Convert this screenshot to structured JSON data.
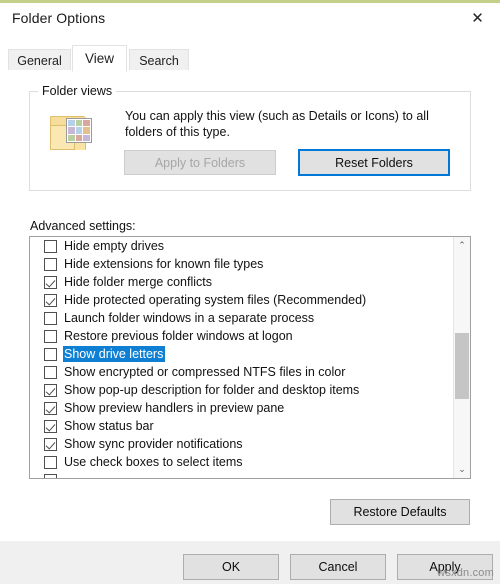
{
  "window": {
    "title": "Folder Options",
    "close_icon": "close-icon",
    "close_glyph": "✕"
  },
  "tabs": [
    {
      "label": "General",
      "selected": false
    },
    {
      "label": "View",
      "selected": true
    },
    {
      "label": "Search",
      "selected": false
    }
  ],
  "folder_views": {
    "legend": "Folder views",
    "description": "You can apply this view (such as Details or Icons) to all folders of this type.",
    "apply_to_folders_label": "Apply to Folders",
    "apply_to_folders_enabled": false,
    "reset_folders_label": "Reset Folders",
    "reset_folders_focused": true,
    "icon": "folder-thumbnails-icon"
  },
  "advanced": {
    "label": "Advanced settings:",
    "items": [
      {
        "label": "Hide empty drives",
        "checked": false,
        "selected": false
      },
      {
        "label": "Hide extensions for known file types",
        "checked": false,
        "selected": false
      },
      {
        "label": "Hide folder merge conflicts",
        "checked": true,
        "selected": false
      },
      {
        "label": "Hide protected operating system files (Recommended)",
        "checked": true,
        "selected": false
      },
      {
        "label": "Launch folder windows in a separate process",
        "checked": false,
        "selected": false
      },
      {
        "label": "Restore previous folder windows at logon",
        "checked": false,
        "selected": false
      },
      {
        "label": "Show drive letters",
        "checked": false,
        "selected": true
      },
      {
        "label": "Show encrypted or compressed NTFS files in color",
        "checked": false,
        "selected": false
      },
      {
        "label": "Show pop-up description for folder and desktop items",
        "checked": true,
        "selected": false
      },
      {
        "label": "Show preview handlers in preview pane",
        "checked": true,
        "selected": false
      },
      {
        "label": "Show status bar",
        "checked": true,
        "selected": false
      },
      {
        "label": "Show sync provider notifications",
        "checked": true,
        "selected": false
      },
      {
        "label": "Use check boxes to select items",
        "checked": false,
        "selected": false
      }
    ],
    "scrollbar": {
      "up_arrow": "⌃",
      "down_arrow": "⌄"
    }
  },
  "restore_defaults_label": "Restore Defaults",
  "footer": {
    "ok_label": "OK",
    "cancel_label": "Cancel",
    "apply_label": "Apply"
  },
  "watermark": "wsxdn.com",
  "colors": {
    "accent_blue": "#0078d7",
    "selection_blue": "#0f7fd4",
    "top_strip": "#c4d08a",
    "button_face": "#e1e1e1",
    "footer_bg": "#f0f0f0"
  }
}
